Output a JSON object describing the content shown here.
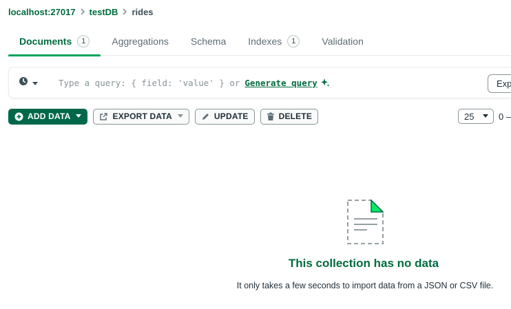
{
  "breadcrumb": {
    "host": "localhost:27017",
    "database": "testDB",
    "collection": "rides"
  },
  "tabs": [
    {
      "label": "Documents",
      "count": "1",
      "active": true
    },
    {
      "label": "Aggregations"
    },
    {
      "label": "Schema"
    },
    {
      "label": "Indexes",
      "count": "1"
    },
    {
      "label": "Validation"
    }
  ],
  "query_bar": {
    "history_icon": "clock-icon",
    "placeholder": "Type a query: { field: 'value' } or",
    "generate_label": "Generate query",
    "generate_icon": "sparkle-icon",
    "explain_label": "Exp"
  },
  "toolbar": {
    "add_data_label": "ADD DATA",
    "export_data_label": "EXPORT DATA",
    "update_label": "UPDATE",
    "delete_label": "DELETE",
    "page_size": "25",
    "range_text": "0 –"
  },
  "empty_state": {
    "title": "This collection has no data",
    "description": "It only takes a few seconds to import data from a JSON or CSV file."
  },
  "colors": {
    "brand_green": "#00684a",
    "link_green": "#016b3f",
    "accent_green": "#00a35c",
    "border_gray": "#889397"
  }
}
